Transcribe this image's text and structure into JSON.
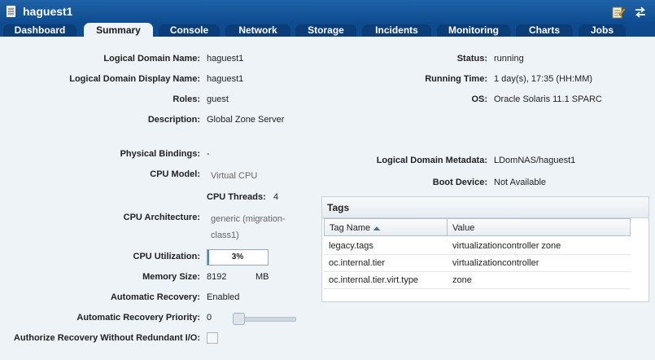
{
  "window": {
    "title": "haguest1",
    "icons": [
      "server-icon",
      "edit-notes-icon",
      "swap-arrows-icon"
    ]
  },
  "tabs": [
    {
      "label": "Dashboard"
    },
    {
      "label": "Summary",
      "active": true
    },
    {
      "label": "Console"
    },
    {
      "label": "Network"
    },
    {
      "label": "Storage"
    },
    {
      "label": "Incidents"
    },
    {
      "label": "Monitoring"
    },
    {
      "label": "Charts"
    },
    {
      "label": "Jobs"
    }
  ],
  "summary": {
    "ldom_name": {
      "label": "Logical Domain Name:",
      "value": "haguest1"
    },
    "ldom_display_name": {
      "label": "Logical Domain Display Name:",
      "value": "haguest1"
    },
    "roles": {
      "label": "Roles:",
      "value": "guest"
    },
    "description": {
      "label": "Description:",
      "value": "Global Zone Server"
    },
    "status": {
      "label": "Status:",
      "value": "running"
    },
    "running_time": {
      "label": "Running Time:",
      "value": "1 day(s), 17:35 (HH:MM)"
    },
    "os": {
      "label": "OS:",
      "value": "Oracle Solaris 11.1 SPARC"
    },
    "physical_bindings": {
      "label": "Physical Bindings:",
      "value": "-"
    },
    "cpu_model": {
      "label": "CPU Model:",
      "value": "Virtual CPU"
    },
    "cpu_threads": {
      "label": "CPU Threads:",
      "value": "4"
    },
    "cpu_architecture": {
      "label": "CPU Architecture:",
      "value_line1": "generic (migration-",
      "value_line2": "class1)"
    },
    "cpu_utilization": {
      "label": "CPU Utilization:",
      "value": "3%",
      "fraction": 0.03
    },
    "memory_size": {
      "label": "Memory Size:",
      "value": "8192",
      "unit": "MB"
    },
    "automatic_recovery": {
      "label": "Automatic Recovery:",
      "value": "Enabled"
    },
    "automatic_recovery_priority": {
      "label": "Automatic Recovery Priority:",
      "value": "0"
    },
    "authorize_recovery": {
      "label": "Authorize Recovery Without Redundant I/O:",
      "checked": false
    },
    "ldom_metadata": {
      "label": "Logical Domain Metadata:",
      "value": "LDomNAS/haguest1"
    },
    "boot_device": {
      "label": "Boot Device:",
      "value": "Not Available"
    }
  },
  "tags": {
    "title": "Tags",
    "columns": [
      "Tag Name",
      "Value"
    ],
    "rows": [
      {
        "name": "legacy.tags",
        "value": "virtualizationcontroller zone"
      },
      {
        "name": "oc.internal.tier",
        "value": "virtualizationcontroller"
      },
      {
        "name": "oc.internal.tier.virt.type",
        "value": "zone"
      }
    ]
  },
  "colors": {
    "titlebar": "#0d4a8e",
    "tab_inactive": "#0b3d78",
    "background": "#eef3f8",
    "progress_fill": "#4a89c8"
  }
}
